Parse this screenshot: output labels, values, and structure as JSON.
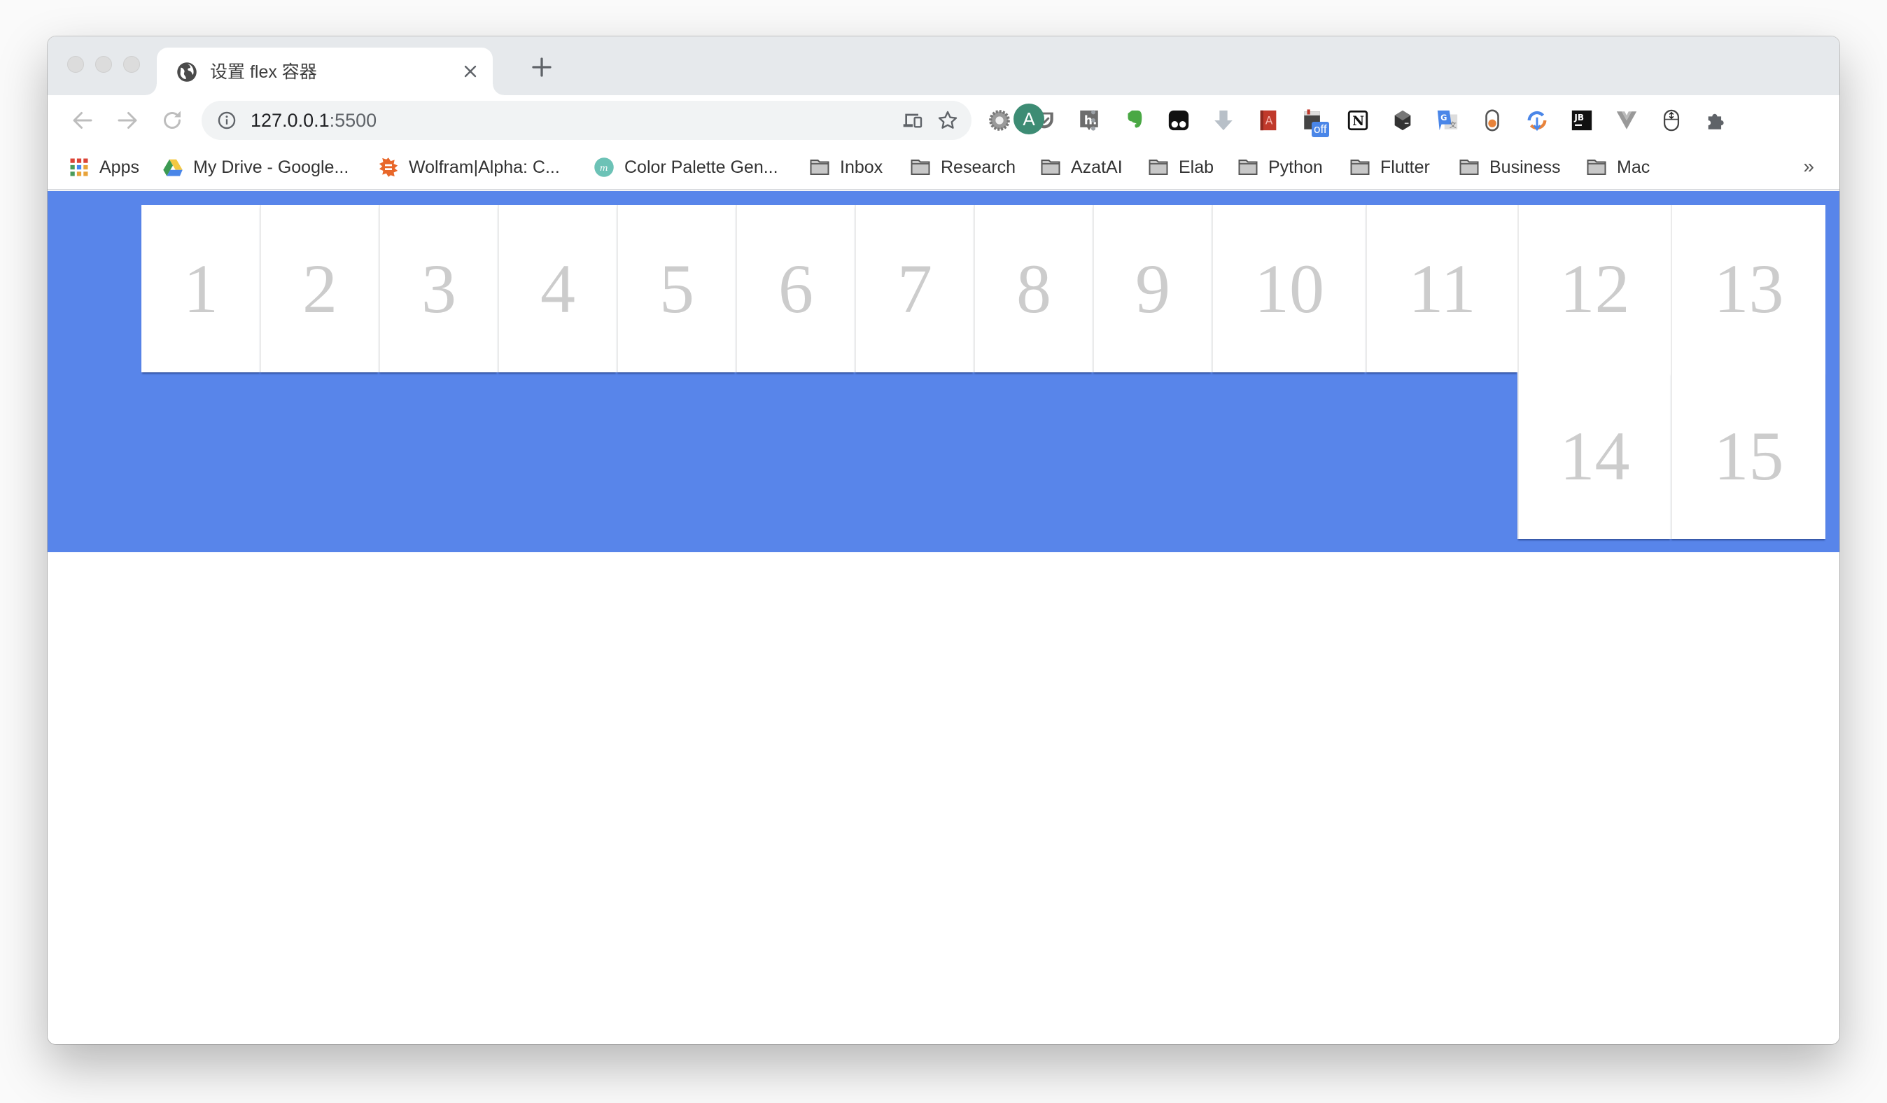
{
  "browser": {
    "tab": {
      "title": "设置 flex 容器",
      "favicon": "globe-icon",
      "close": "close-icon"
    },
    "new_tab_label": "+",
    "toolbar": {
      "back": "back-arrow-icon",
      "forward": "forward-arrow-icon",
      "reload": "reload-icon",
      "url_host": "127.0.0.1",
      "url_port": ":5500",
      "site_info": "info-icon",
      "cast": "devices-icon",
      "bookmark_star": "star-icon"
    },
    "extensions": [
      "gear-extension-icon",
      "pocket-icon",
      "hypothesis-icon",
      "evernote-icon",
      "tampermonkey-icon",
      "download-icon",
      "dictionary-icon",
      "off-badge-extension-icon",
      "notion-icon",
      "box-icon",
      "google-translate-icon",
      "toggle-extension-icon",
      "sync-extension-icon",
      "jetbrains-icon",
      "vue-devtools-icon",
      "mouse-icon",
      "puzzle-icon"
    ],
    "off_badge": "off",
    "avatar_letter": "A",
    "bookmarks": [
      {
        "label": "Apps",
        "icon": "apps-grid-icon"
      },
      {
        "label": "My Drive - Google...",
        "icon": "google-drive-icon"
      },
      {
        "label": "Wolfram|Alpha: C...",
        "icon": "wolfram-icon"
      },
      {
        "label": "Color Palette Gen...",
        "icon": "color-palette-icon"
      },
      {
        "label": "Inbox",
        "icon": "folder-icon"
      },
      {
        "label": "Research",
        "icon": "folder-icon"
      },
      {
        "label": "AzatAI",
        "icon": "folder-icon"
      },
      {
        "label": "Elab",
        "icon": "folder-icon"
      },
      {
        "label": "Python",
        "icon": "folder-icon"
      },
      {
        "label": "Flutter",
        "icon": "folder-icon"
      },
      {
        "label": "Business",
        "icon": "folder-icon"
      },
      {
        "label": "Mac",
        "icon": "folder-icon"
      }
    ],
    "bookmarks_overflow": "»"
  },
  "page": {
    "container_color": "#5885ea",
    "item_text_color": "#cccccc",
    "items": [
      "1",
      "2",
      "3",
      "4",
      "5",
      "6",
      "7",
      "8",
      "9",
      "10",
      "11",
      "12",
      "13",
      "14",
      "15"
    ]
  }
}
